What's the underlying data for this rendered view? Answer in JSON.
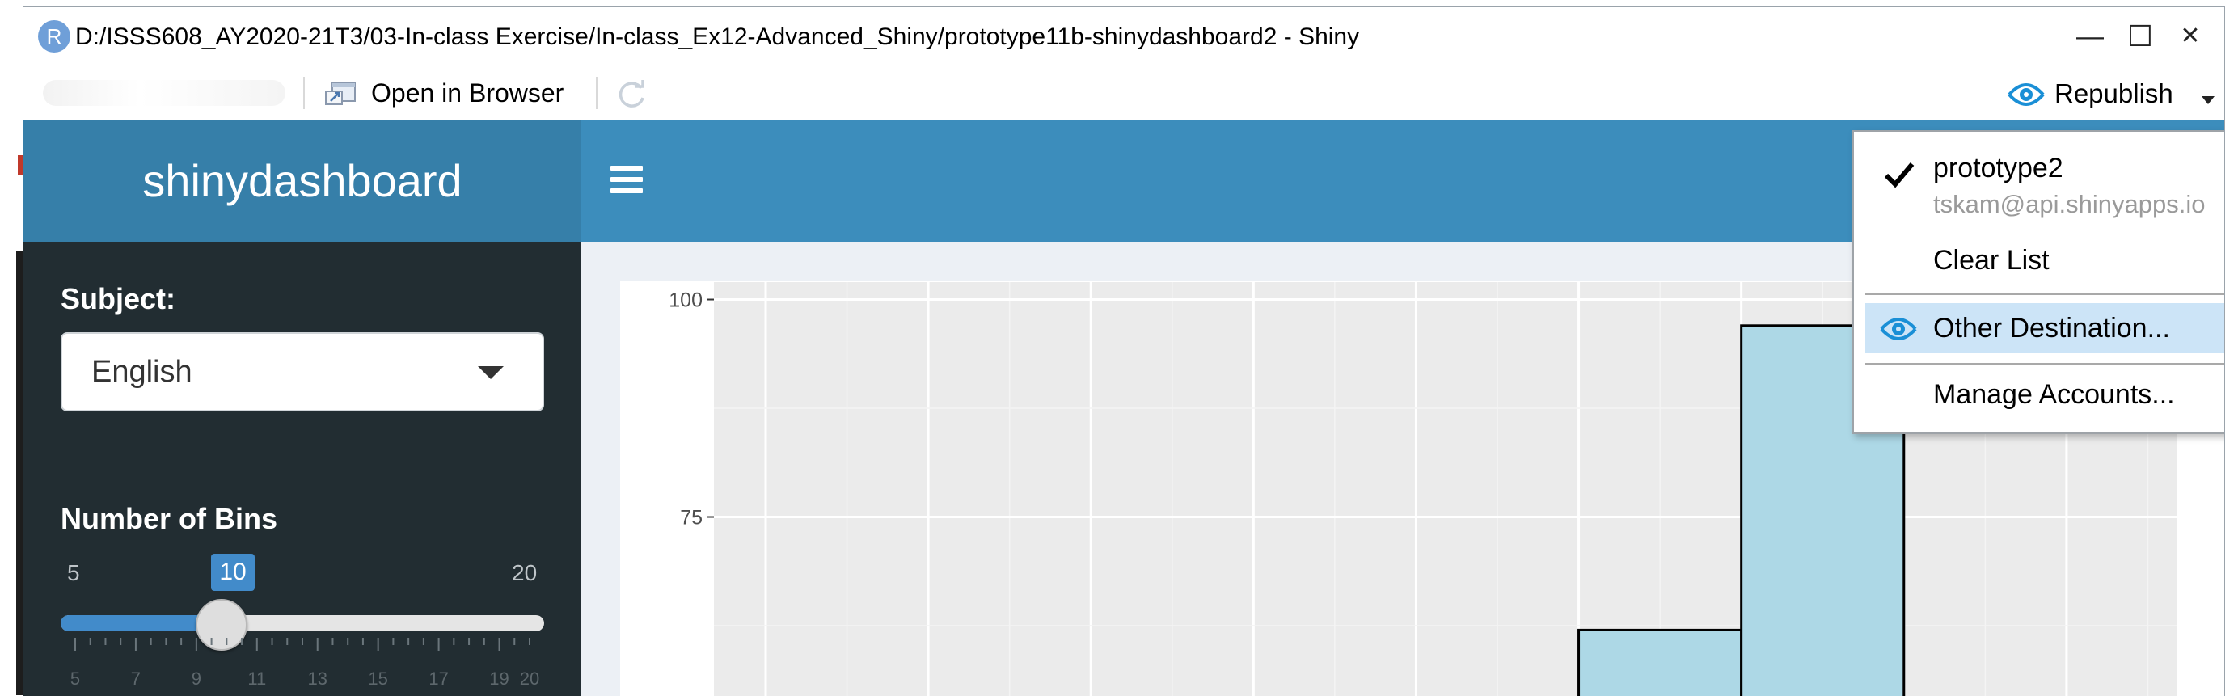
{
  "window": {
    "title": "D:/ISSS608_AY2020-21T3/03-In-class Exercise/In-class_Ex12-Advanced_Shiny/prototype11b-shinydashboard2 - Shiny",
    "r_logo": "R",
    "minimize": "—",
    "maximize": "☐",
    "close": "✕"
  },
  "toolbar": {
    "open_in_browser": "Open in Browser",
    "republish": "Republish"
  },
  "dashboard": {
    "brand": "shinydashboard",
    "subject_label": "Subject:",
    "subject_value": "English",
    "bins_label": "Number of Bins",
    "slider": {
      "min": "5",
      "max": "20",
      "value": "10",
      "value_num": 10,
      "min_num": 5,
      "max_num": 20,
      "tick_labels": [
        "5",
        "7",
        "9",
        "11",
        "13",
        "15",
        "17",
        "19",
        "20"
      ]
    }
  },
  "publish_menu": {
    "account_name": "prototype2",
    "account_server": "tskam@api.shinyapps.io",
    "clear_list": "Clear List",
    "other_destination": "Other Destination...",
    "manage_accounts": "Manage Accounts..."
  },
  "colors": {
    "navbar": "#3c8dbc",
    "brand_bg": "#367fa9",
    "sidebar": "#222d32",
    "bar_fill": "#add8e6",
    "publish_icon": "#1a8fd6"
  },
  "chart_data": {
    "type": "bar",
    "yticks": [
      "100",
      "75"
    ],
    "ylim_visible": [
      52,
      102
    ],
    "bars": [
      {
        "bin": 5,
        "value": 62
      },
      {
        "bin": 6,
        "value": 97
      }
    ],
    "bin_count": 9
  }
}
